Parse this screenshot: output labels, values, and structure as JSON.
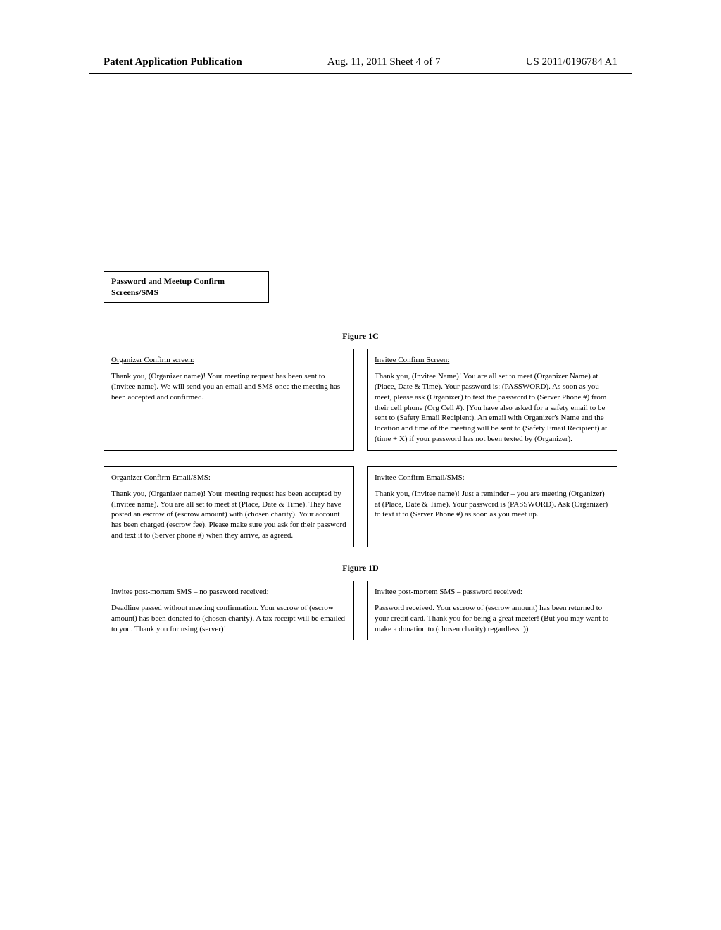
{
  "header": {
    "left": "Patent Application Publication",
    "center": "Aug. 11, 2011  Sheet 4 of 7",
    "right": "US 2011/0196784 A1"
  },
  "labelBox": "Password and Meetup Confirm Screens/SMS",
  "figure1c": {
    "caption": "Figure 1C",
    "boxes": [
      {
        "title": "Organizer Confirm screen:",
        "body": "Thank you, (Organizer name)! Your meeting request has been sent to (Invitee name). We will send you an email and SMS once the meeting has been accepted and confirmed."
      },
      {
        "title": "Invitee Confirm Screen:",
        "body": "Thank you, (Invitee Name)! You are all set to meet (Organizer Name) at (Place, Date & Time). Your password is: (PASSWORD). As soon as you meet, please ask (Organizer) to text the password to (Server Phone #) from their cell phone (Org Cell #). [You have also asked for a safety email to be sent to (Safety Email Recipient). An email with Organizer's Name and the location and time of the meeting will be sent to (Safety Email Recipient) at (time + X) if your password has not been texted by (Organizer)."
      },
      {
        "title": "Organizer Confirm Email/SMS:",
        "body": "Thank you, (Organizer name)! Your meeting request has been accepted by (Invitee name). You are all set to meet at (Place, Date & Time). They have posted an escrow of (escrow amount) with (chosen charity). Your account has been charged (escrow fee). Please make sure you ask for their password and text it to (Server phone #) when they arrive, as agreed."
      },
      {
        "title": "Invitee Confirm Email/SMS:",
        "body": "Thank you, (Invitee name)! Just a reminder – you are meeting (Organizer) at (Place, Date & Time). Your password is (PASSWORD). Ask (Organizer) to text it to (Server Phone #) as soon as you meet up."
      }
    ]
  },
  "figure1d": {
    "caption": "Figure 1D",
    "boxes": [
      {
        "title": "Invitee post-mortem SMS – no password received:",
        "body": "Deadline passed without meeting confirmation. Your escrow of (escrow amount) has been donated to (chosen charity). A tax receipt will be emailed to you. Thank you for using (server)!"
      },
      {
        "title": "Invitee post-mortem SMS – password received:",
        "body": "Password received. Your escrow of (escrow amount) has been returned to your credit card. Thank you for being a great meeter! (But you may want to make a donation to (chosen charity) regardless :))"
      }
    ]
  }
}
